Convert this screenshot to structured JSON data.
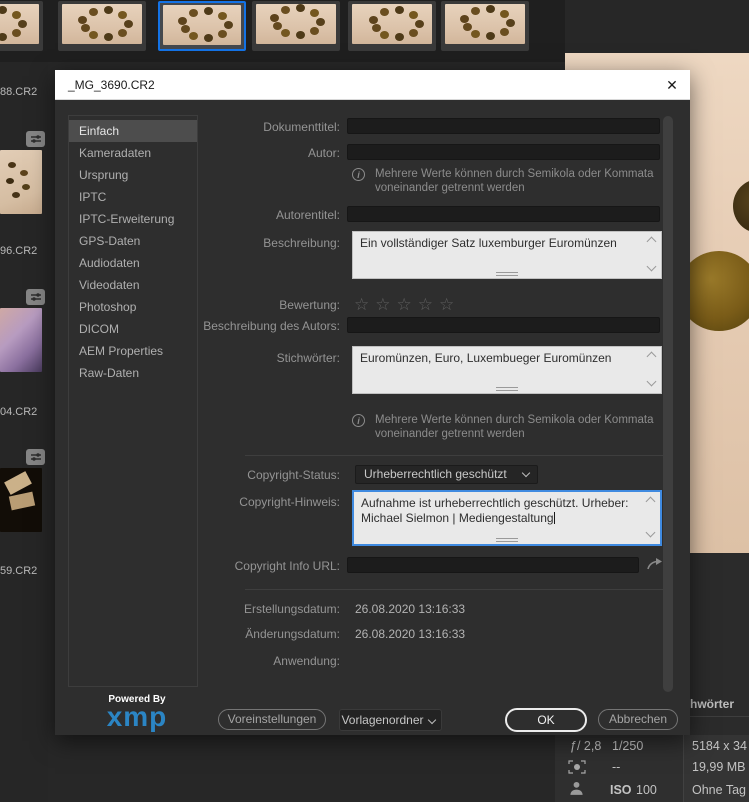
{
  "icons": {
    "close": "✕",
    "star": "☆",
    "info": "i"
  },
  "left_files": {
    "f0": "88.CR2",
    "f1": "96.CR2",
    "f2": "04.CR2",
    "f3": "59.CR2"
  },
  "dialog": {
    "title": "_MG_3690.CR2",
    "tabs": [
      "Einfach",
      "Kameradaten",
      "Ursprung",
      "IPTC",
      "IPTC-Erweiterung",
      "GPS-Daten",
      "Audiodaten",
      "Videodaten",
      "Photoshop",
      "DICOM",
      "AEM Properties",
      "Raw-Daten"
    ],
    "selected_tab": "Einfach",
    "labels": {
      "dokumenttitel": "Dokumenttitel:",
      "autor": "Autor:",
      "autorentitel": "Autorentitel:",
      "beschreibung": "Beschreibung:",
      "bewertung": "Bewertung:",
      "beschreibung_des_autors": "Beschreibung des Autors:",
      "stichwoerter": "Stichwörter:",
      "copyright_status": "Copyright-Status:",
      "copyright_hinweis": "Copyright-Hinweis:",
      "copyright_info_url": "Copyright Info URL:",
      "erstellungsdatum": "Erstellungsdatum:",
      "aenderungsdatum": "Änderungsdatum:",
      "anwendung": "Anwendung:"
    },
    "values": {
      "beschreibung": "Ein vollständiger Satz luxemburger Euromünzen",
      "stichwoerter": "Euromünzen, Euro, Luxembueger Euromünzen",
      "copyright_status": "Urheberrechtlich geschützt",
      "copyright_hinweis": "Aufnahme ist urheberrechtlich geschützt. Urheber: Michael Sielmon | Mediengestaltung",
      "erstellungsdatum": "26.08.2020 13:16:33",
      "aenderungsdatum": "26.08.2020 13:16:33"
    },
    "info_note": "Mehrere Werte können durch Semikola oder Kommata voneinander getrennt werden",
    "footer": {
      "powered_by": "Powered By",
      "xmp": "xmp",
      "voreinstellungen": "Voreinstellungen",
      "vorlagenordner": "Vorlagenordner",
      "ok": "OK",
      "abbrechen": "Abbrechen"
    }
  },
  "right_panel": {
    "keywords_header_partial": "hwörter",
    "placard": {
      "aperture": "ƒ/ 2,8",
      "shutter": "1/250",
      "metering_value": "--",
      "iso_label": "ISO",
      "iso_value": "100",
      "dimensions": "5184 x 34",
      "filesize": "19,99 MB",
      "tags": "Ohne Tag"
    }
  },
  "colors": {
    "accent_blue": "#1473e6",
    "focus_border": "#3f8ae0",
    "xmp_blue": "#2b85c4"
  }
}
